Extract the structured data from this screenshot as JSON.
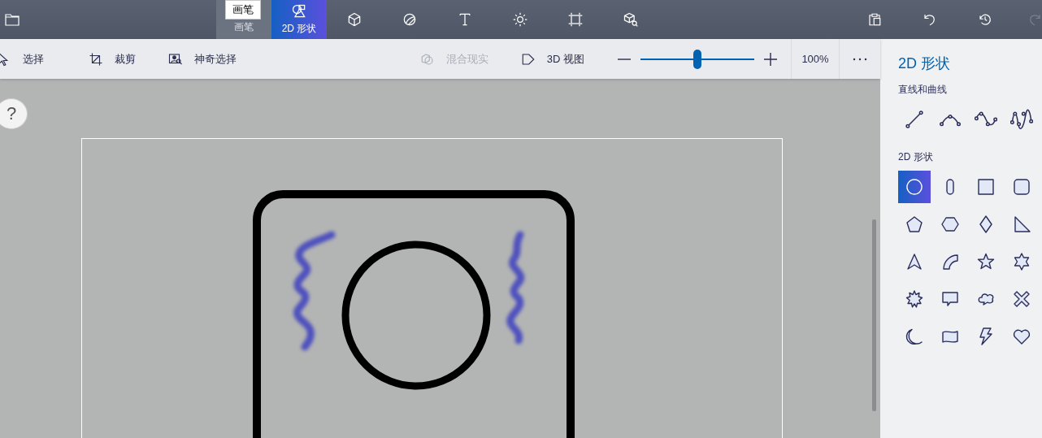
{
  "top_bar": {
    "tooltip": "画笔",
    "tabs": [
      {
        "label": "画笔",
        "selected": false,
        "hovered": true
      },
      {
        "label": "2D 形状",
        "selected": true,
        "hovered": false
      },
      {
        "selected": false,
        "hovered": false
      },
      {
        "selected": false,
        "hovered": false
      },
      {
        "selected": false,
        "hovered": false
      },
      {
        "selected": false,
        "hovered": false
      },
      {
        "selected": false,
        "hovered": false
      },
      {
        "selected": false,
        "hovered": false
      }
    ],
    "actions": [
      {
        "disabled": false
      },
      {
        "disabled": false
      },
      {
        "disabled": false
      },
      {
        "disabled": true
      }
    ]
  },
  "toolbar": {
    "tools": [
      {
        "label": "选择",
        "disabled": false
      },
      {
        "label": "裁剪",
        "disabled": false
      },
      {
        "label": "神奇选择",
        "disabled": false
      },
      {
        "label": "混合现实",
        "disabled": true
      },
      {
        "label": "3D 视图",
        "disabled": false
      }
    ],
    "zoom": {
      "level": 0.5,
      "reading": "100%"
    }
  },
  "canvas": {
    "help": "?"
  },
  "panel": {
    "title": "2D 形状",
    "sections": [
      {
        "title": "直线和曲线",
        "items": [
          {
            "selected": false
          },
          {
            "selected": false
          },
          {
            "selected": false
          },
          {
            "selected": false
          }
        ]
      },
      {
        "title": "2D 形状",
        "items": [
          {
            "selected": true
          },
          {
            "selected": false
          },
          {
            "selected": false
          },
          {
            "selected": false
          },
          {
            "selected": false
          },
          {
            "selected": false
          },
          {
            "selected": false
          },
          {
            "selected": false
          },
          {
            "selected": false
          },
          {
            "selected": false
          },
          {
            "selected": false
          },
          {
            "selected": false
          },
          {
            "selected": false
          },
          {
            "selected": false
          },
          {
            "selected": false
          },
          {
            "selected": false
          },
          {
            "selected": false
          },
          {
            "selected": false
          },
          {
            "selected": false
          },
          {
            "selected": false
          }
        ]
      }
    ]
  }
}
